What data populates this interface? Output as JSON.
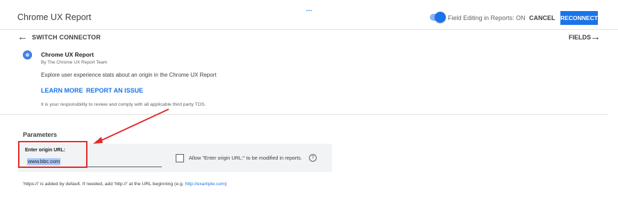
{
  "header": {
    "app_title": "Chrome UX Report",
    "drag_handle": "....",
    "field_editing_label": "Field Editing in Reports: ON",
    "field_editing_on": true,
    "cancel_label": "CANCEL",
    "reconnect_label": "RECONNECT"
  },
  "subnav": {
    "back_icon": "arrow-left-icon",
    "switch_connector_label": "SWITCH CONNECTOR",
    "fields_label": "FIELDS",
    "forward_icon": "arrow-right-icon"
  },
  "connector": {
    "icon": "connector-icon",
    "name": "Chrome UX Report",
    "by": "By The Chrome UX Report Team",
    "description": "Explore user experience stats about an origin in the Chrome UX Report",
    "learn_more_label": "LEARN MORE",
    "report_issue_label": "REPORT AN ISSUE",
    "tos_text": "It is your responsibility to review and comply with all applicable third party TOS."
  },
  "parameters": {
    "title": "Parameters",
    "origin_url_label": "Enter origin URL:",
    "origin_url_value": "www.bbc.com",
    "allow_modify_label": "Allow \"Enter origin URL:\" to be modified in reports.",
    "allow_modify_checked": false,
    "help_icon": "?",
    "note_prefix": "'https://' is added by default. If needed, add 'http://' at the URL beginning (e.g. ",
    "note_link": "http://example.com",
    "note_suffix": ")"
  },
  "colors": {
    "accent": "#1a73e8",
    "annotation": "#e32b2b"
  }
}
